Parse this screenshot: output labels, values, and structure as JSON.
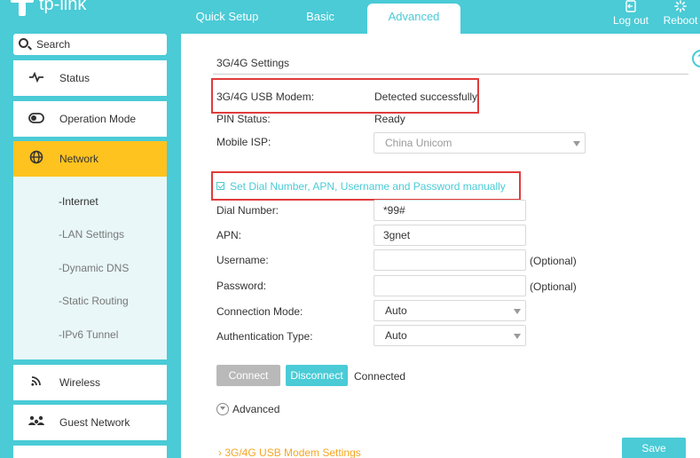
{
  "header": {
    "logo_text": "tp-link",
    "tabs": [
      {
        "label": "Quick Setup"
      },
      {
        "label": "Basic"
      },
      {
        "label": "Advanced"
      }
    ],
    "logout_label": "Log out",
    "reboot_label": "Reboot"
  },
  "sidebar": {
    "search_placeholder": "Search",
    "items": [
      {
        "label": "Status",
        "icon": "pulse-icon"
      },
      {
        "label": "Operation Mode",
        "icon": "toggle-icon"
      },
      {
        "label": "Network",
        "icon": "globe-icon",
        "active": true
      },
      {
        "label": "Wireless",
        "icon": "wifi-icon"
      },
      {
        "label": "Guest Network",
        "icon": "guest-network-icon"
      }
    ],
    "subitems": [
      {
        "label": "-Internet",
        "selected": true
      },
      {
        "label": "-LAN Settings"
      },
      {
        "label": "-Dynamic DNS"
      },
      {
        "label": "-Static Routing"
      },
      {
        "label": "-IPv6 Tunnel"
      }
    ]
  },
  "main": {
    "section_title": "3G/4G Settings",
    "usb_modem_label": "3G/4G USB Modem:",
    "usb_modem_value": "Detected successfully",
    "pin_status_label": "PIN Status:",
    "pin_status_value": "Ready",
    "mobile_isp_label": "Mobile ISP:",
    "mobile_isp_value": "China Unicom",
    "manual_checkbox_label": "Set Dial Number, APN, Username and Password manually",
    "dial_number_label": "Dial Number:",
    "dial_number_value": "*99#",
    "apn_label": "APN:",
    "apn_value": "3gnet",
    "username_label": "Username:",
    "username_value": "",
    "username_hint": "(Optional)",
    "password_label": "Password:",
    "password_value": "",
    "password_hint": "(Optional)",
    "connection_mode_label": "Connection Mode:",
    "connection_mode_value": "Auto",
    "auth_type_label": "Authentication Type:",
    "auth_type_value": "Auto",
    "connect_label": "Connect",
    "disconnect_label": "Disconnect",
    "connection_status": "Connected",
    "advanced_label": "Advanced",
    "modem_settings_link": "3G/4G USB Modem Settings",
    "save_label": "Save"
  },
  "colors": {
    "accent": "#4acbd6",
    "active_item": "#ffc31f",
    "highlight_box": "#e03c3c",
    "link_orange": "#f5a623"
  }
}
